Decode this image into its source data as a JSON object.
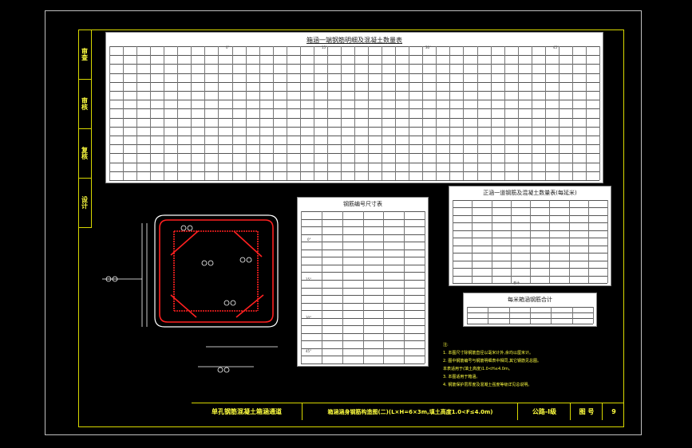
{
  "sidebar": {
    "cells": [
      "审查",
      "审核",
      "复核",
      "设计"
    ]
  },
  "main_table": {
    "title": "箱涵一端钢筋明细及混凝土数量表",
    "degree_headers": [
      "0°",
      "15°",
      "30°",
      "45°"
    ]
  },
  "bend_table": {
    "title": "钢筋编号尺寸表",
    "group_labels": [
      "0°",
      "15°",
      "30°",
      "45°"
    ],
    "footer": "注:尺寸以mm计"
  },
  "summary_table": {
    "title": "正涵一道钢筋及混凝土数量表(每延米)",
    "footer": "合计"
  },
  "ratio_table": {
    "title": "每米箱涵钢筋合计"
  },
  "notes": {
    "heading": "注:",
    "items": [
      "1. 本图尺寸除钢筋直径以毫米计外,余均以厘米计。",
      "2. 图中钢筋编号与钢筋明细表中相同,其它钢筋见总图。",
      "   本表适用于(填土高度)1.0<H≤4.0m。",
      "3. 本图适用于箱涵。",
      "4. 钢筋保护层厚度及混凝土强度等级详见总说明。"
    ]
  },
  "title_block": {
    "project": "单孔钢筋混凝土箱涵通道",
    "drawing": "箱涵涵身钢筋构造图(二)(L×H=6×3m,填土高度1.0<F≤4.0m)",
    "grade": "公路-Ⅰ级",
    "sheet_label": "图 号",
    "sheet_no": "9"
  }
}
